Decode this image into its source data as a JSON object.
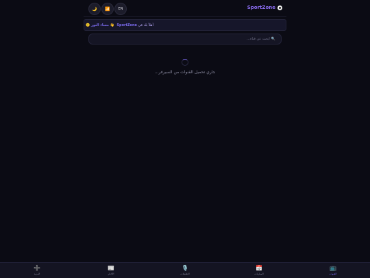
{
  "header": {
    "theme_icon": "🌙",
    "stats_icon": "📶",
    "language_label": "EN",
    "brand_name": "SportZone"
  },
  "welcome": {
    "emoji": "👋",
    "text": "أهلاً بك في",
    "brand": "SportZone",
    "suffix": "مساء النور 🙂"
  },
  "search": {
    "placeholder": "ابحث عن قناة..."
  },
  "loading": {
    "message": "جاري تحميل القنوات من السيرفر..."
  },
  "bottom_nav": [
    {
      "icon": "➕",
      "label": "المزيد"
    },
    {
      "icon": "📰",
      "label": "الأخبار"
    },
    {
      "icon": "🎙️",
      "label": "التعليقات"
    },
    {
      "icon": "📅",
      "label": "المباريات"
    },
    {
      "icon": "📺",
      "label": "القنوات",
      "active": true
    }
  ]
}
